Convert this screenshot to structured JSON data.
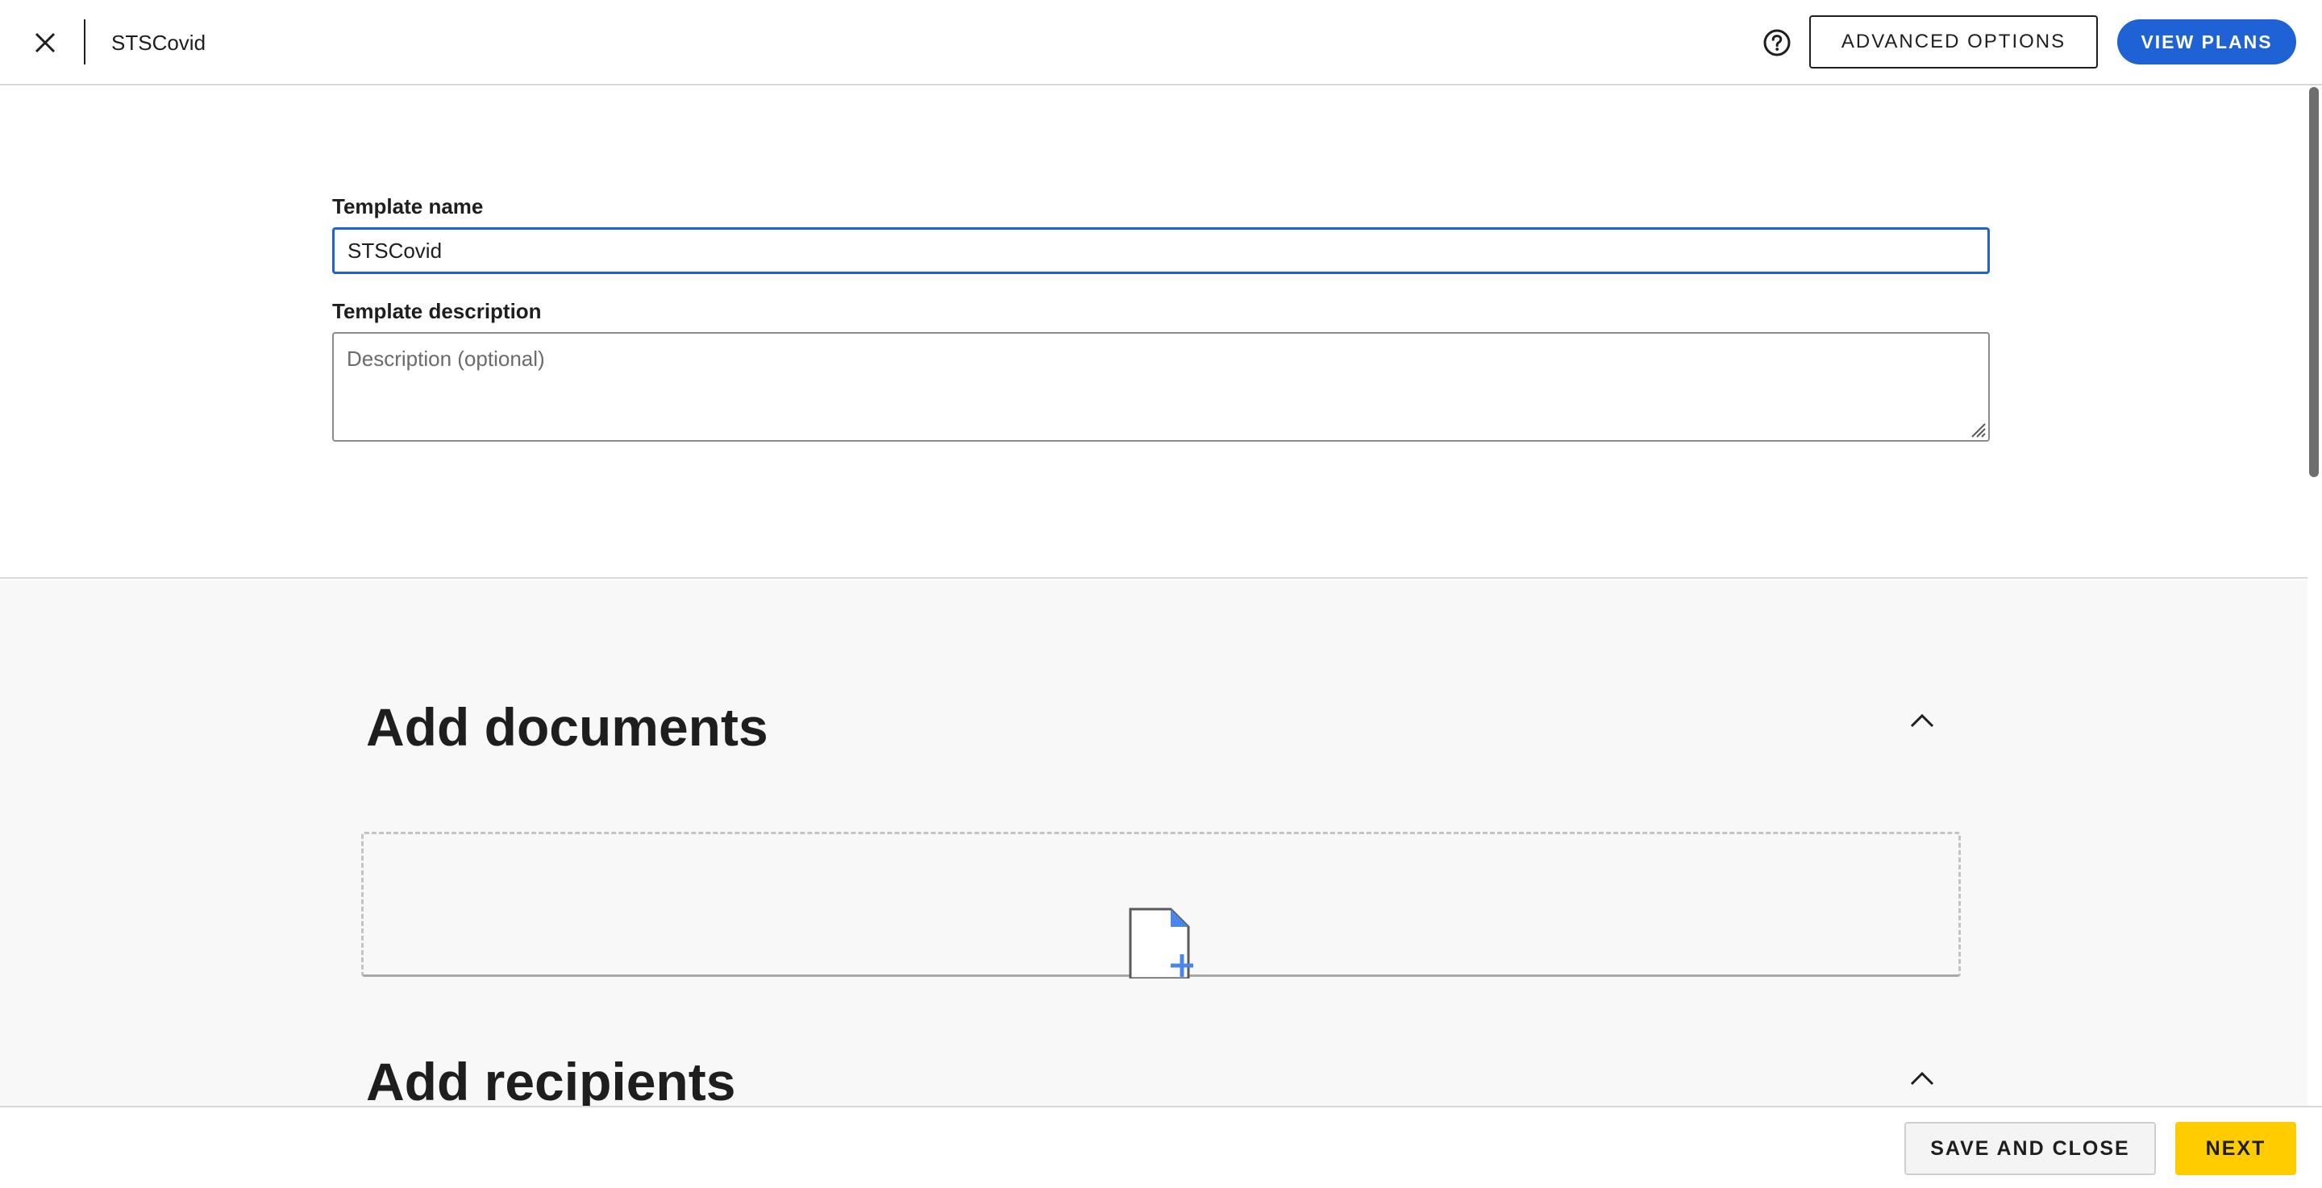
{
  "header": {
    "title": "STSCovid",
    "close_icon": "close-icon",
    "help_icon": "help-circle-icon",
    "advanced_options_label": "ADVANCED OPTIONS",
    "view_plans_label": "VIEW PLANS",
    "view_plans_color": "#1f62d6"
  },
  "form": {
    "template_name_label": "Template name",
    "template_name_value": "STSCovid",
    "template_description_label": "Template description",
    "template_description_placeholder": "Description (optional)",
    "template_description_value": ""
  },
  "sections": {
    "add_documents": {
      "heading": "Add documents",
      "collapse_icon": "chevron-up-icon",
      "dropzone_icon": "document-add-icon"
    },
    "add_recipients": {
      "heading": "Add recipients",
      "collapse_icon": "chevron-up-icon"
    }
  },
  "footer": {
    "save_and_close_label": "SAVE AND CLOSE",
    "next_label": "NEXT",
    "next_color": "#ffcc00"
  }
}
